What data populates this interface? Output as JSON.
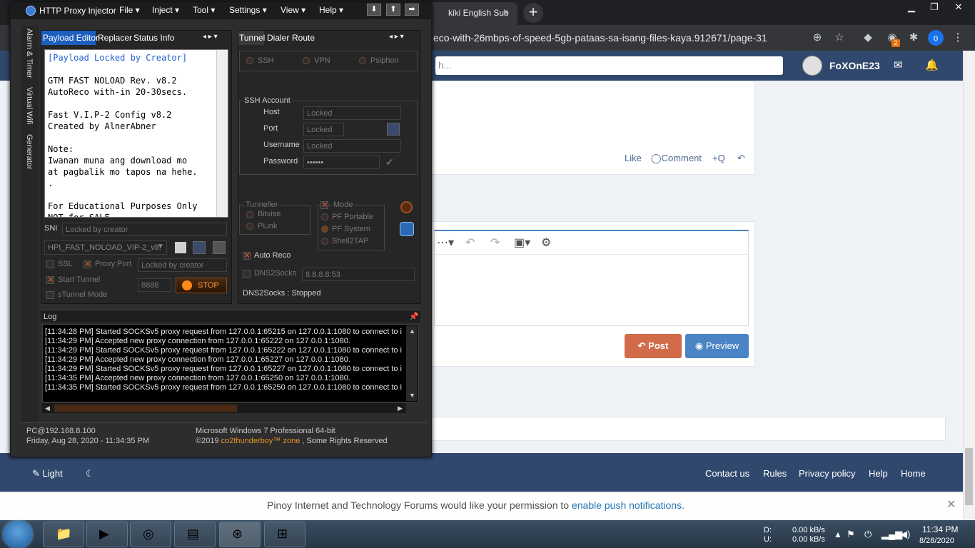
{
  "browser": {
    "tab_title": "kiki English Sub",
    "close_tab": "×",
    "new_tab": "+",
    "address": "eco-with-26mbps-of-speed-5gb-pataas-sa-isang-files-kaya.912671/page-31",
    "profile_initial": "o",
    "extension_badge": "2"
  },
  "site": {
    "search_placeholder": "h...",
    "username": "FoXOnE23",
    "post_actions": {
      "like": "Like",
      "comment": "Comment",
      "quote": "+Q"
    },
    "post_button": "Post",
    "preview_button": "Preview",
    "footer": {
      "light": "Light",
      "links": [
        "Contact us",
        "Rules",
        "Privacy policy",
        "Help",
        "Home"
      ]
    },
    "notice_text": "Pinoy Internet and Technology Forums would like your permission to ",
    "notice_link": "enable push notifications."
  },
  "injector": {
    "title": "HTTP Proxy Injector",
    "menus": [
      "File",
      "Inject",
      "Tool",
      "Settings",
      "View",
      "Help"
    ],
    "side_tabs": [
      "Alarm & Timer",
      "Virtual Wifi",
      "Generator"
    ],
    "left_tabs": [
      "Payload Editor",
      "Replacer",
      "Status Info"
    ],
    "right_tabs": [
      "Tunnel",
      "Dialer",
      "Route"
    ],
    "payload_lines": [
      "[Payload Locked by Creator]",
      "",
      "GTM FAST NOLOAD Rev. v8.2",
      "AutoReco with-in 20-30secs.",
      "",
      "Fast V.I.P-2 Config v8.2",
      "Created by AlnerAbner",
      "",
      "Note:",
      "Iwanan muna ang download mo",
      "at pagbalik mo tapos na hehe.",
      ".",
      "",
      "For Educational Purposes Only",
      "NOT for SALE"
    ],
    "sni_label": "SNI",
    "sni_value": "Locked by creator",
    "config_select": "HPI_FAST_NOLOAD_VIP-2_v8.",
    "ssl_label": "SSL",
    "proxy_port_label": "Proxy:Port",
    "proxy_value": "Locked by creator",
    "start_tunnel_label": "Start Tunnel",
    "stunnel_label": "sTunnel Mode",
    "port_value": "8888",
    "stop_button": "STOP",
    "modes": [
      "SSH",
      "VPN",
      "Psiphon"
    ],
    "ssh_account_label": "SSH Account",
    "host_label": "Host",
    "host_value": "Locked",
    "port_label": "Port",
    "port_field": "Locked",
    "username_label": "Username",
    "username_value": "Locked",
    "password_label": "Password",
    "password_value": "••••••",
    "tunneller_label": "Tunneller",
    "tunnellers": [
      "Bitvise",
      "PLink"
    ],
    "mode_label": "Mode",
    "mode_options": [
      "PF Portable",
      "PF System",
      "Shell2TAP"
    ],
    "auto_reco_label": "Auto Reco",
    "dns2socks_label": "DNS2Socks",
    "dns_value": "8.8.8.8:53",
    "dns_status": "DNS2Socks : Stopped",
    "log_label": "Log",
    "log_lines": [
      "[11:34:28 PM] Started SOCKSv5 proxy request from 127.0.0.1:65215 on 127.0.0.1:1080 to connect to i",
      "[11:34:29 PM] Accepted new proxy connection from 127.0.0.1:65222 on 127.0.0.1:1080.",
      "[11:34:29 PM] Started SOCKSv5 proxy request from 127.0.0.1:65222 on 127.0.0.1:1080 to connect to i",
      "[11:34:29 PM] Accepted new proxy connection from 127.0.0.1:65227 on 127.0.0.1:1080.",
      "[11:34:29 PM] Started SOCKSv5 proxy request from 127.0.0.1:65227 on 127.0.0.1:1080 to connect to i",
      "[11:34:35 PM] Accepted new proxy connection from 127.0.0.1:65250 on 127.0.0.1:1080.",
      "[11:34:35 PM] Started SOCKSv5 proxy request from 127.0.0.1:65250 on 127.0.0.1:1080 to connect to i"
    ],
    "footer_pc": "PC@192.168.8.100",
    "footer_date": "Friday, Aug 28, 2020 - 11:34:35 PM",
    "footer_os": "Microsoft Windows 7 Professional  64-bit",
    "footer_copy_prefix": "©2019 ",
    "footer_copy_brand": "co2thunderboy™ zone",
    "footer_copy_suffix": " , Some Rights Reserved"
  },
  "taskbar": {
    "drive_d": "D:",
    "drive_u": "U:",
    "speed_down": "0.00 kB/s",
    "speed_up": "0.00 kB/s",
    "time": "11:34 PM",
    "date": "8/28/2020"
  }
}
